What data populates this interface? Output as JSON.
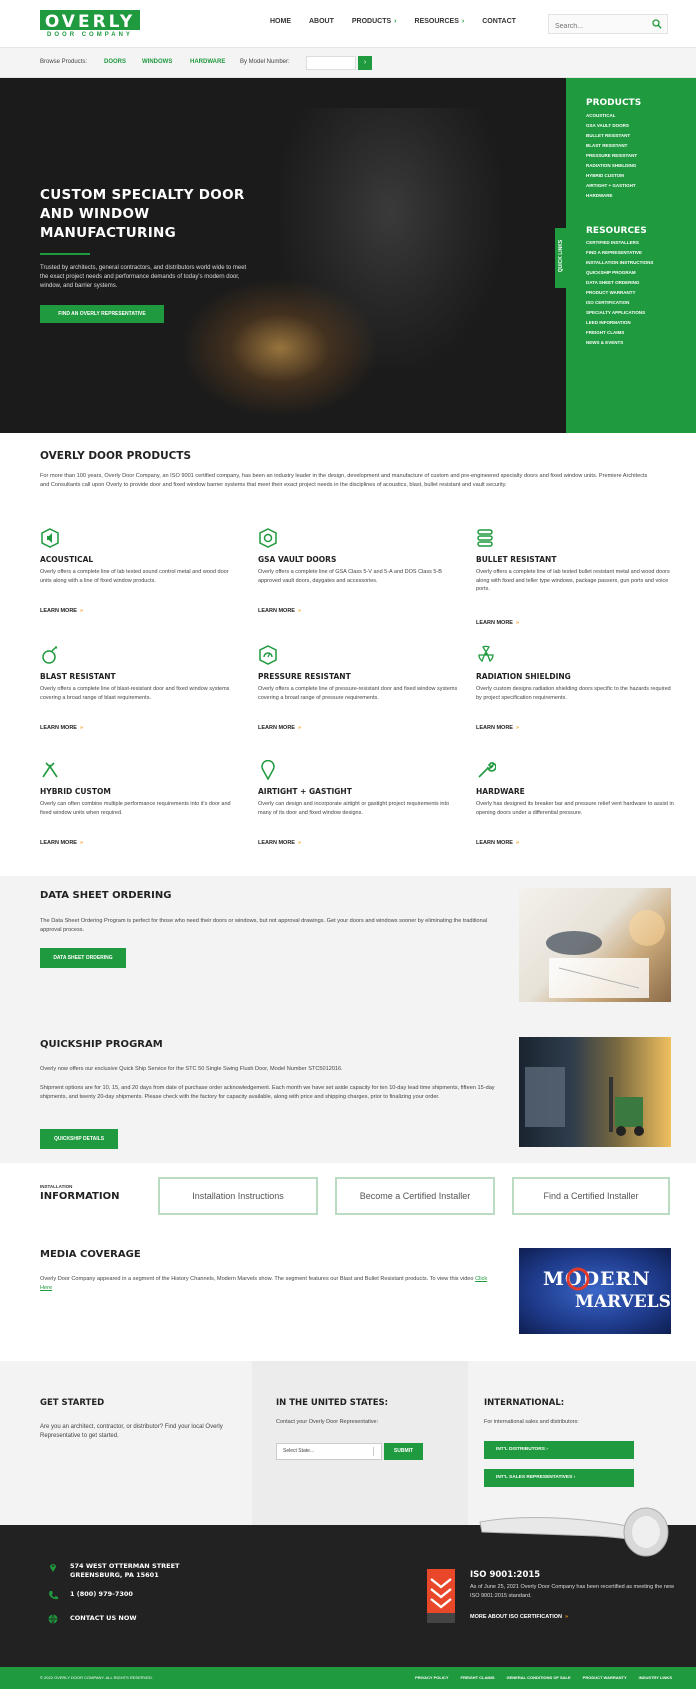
{
  "header": {
    "logo_main": "OVERLY",
    "logo_sub": "DOOR COMPANY",
    "nav": [
      {
        "label": "HOME",
        "chevron": ""
      },
      {
        "label": "ABOUT",
        "chevron": ""
      },
      {
        "label": "PRODUCTS",
        "chevron": "›"
      },
      {
        "label": "RESOURCES",
        "chevron": "›"
      },
      {
        "label": "CONTACT",
        "chevron": ""
      }
    ],
    "search_placeholder": "Search..."
  },
  "browse": {
    "label": "Browse Products:",
    "doors": "DOORS",
    "windows": "WINDOWS",
    "hardware": "HARDWARE",
    "model_label": "By Model Number:",
    "go": "›"
  },
  "hero": {
    "title": "CUSTOM SPECIALTY DOOR AND WINDOW MANUFACTURING",
    "text": "Trusted by architects, general contractors, and distributors world wide to meet the exact project needs and performance demands of today's modern door, window, and barrier systems.",
    "cta": "FIND AN OVERLY REPRESENTATIVE",
    "quick_links": "QUICK LINKS"
  },
  "side_menu": {
    "products_heading": "PRODUCTS",
    "products": [
      "ACOUSTICAL",
      "GSA VAULT DOORS",
      "BULLET RESISTANT",
      "BLAST RESISTANT",
      "PRESSURE RESISTANT",
      "RADIATION SHIELDING",
      "HYBRID CUSTOM",
      "AIRTIGHT + GASTIGHT",
      "HARDWARE"
    ],
    "resources_heading": "RESOURCES",
    "resources": [
      "CERTIFIED INSTALLERS",
      "FIND A REPRESENTATIVE",
      "INSTALLATION INSTRUCTIONS",
      "QUICKSHIP PROGRAM",
      "DATA SHEET ORDERING",
      "PRODUCT WARRANTY",
      "ISO CERTIFICATION",
      "SPECIALTY APPLICATIONS",
      "LEED INFORMATION",
      "FREIGHT CLAIMS",
      "NEWS & EVENTS"
    ]
  },
  "products": {
    "title": "OVERLY DOOR PRODUCTS",
    "intro": "For more than 100 years, Overly Door Company, an ISO 9001 certified company, has been an industry leader in the design, development and manufacture of custom and pre-engineered specialty doors and fixed window units. Premiere Architects and Consultants call upon Overly to provide door and fixed window barrier systems that meet their exact project needs in the disciplines of acoustics, blast, bullet resistant and vault security.",
    "learn_more": "LEARN MORE",
    "arrow": "»",
    "items": [
      {
        "title": "ACOUSTICAL",
        "text": "Overly offers a complete line of lab tested sound control metal and wood door units along with a line of fixed window products.",
        "icon": "acoustical-icon"
      },
      {
        "title": "GSA VAULT DOORS",
        "text": "Overly offers a complete line of GSA Class 5-V and 5-A and DOS Class 5-B approved vault doors, daygates and accessories.",
        "icon": "vault-icon"
      },
      {
        "title": "BULLET RESISTANT",
        "text": "Overly offers a complete line of lab tested bullet resistant metal and wood doors along with fixed and teller type windows, package passers, gun ports and voice ports.",
        "icon": "bullet-icon"
      },
      {
        "title": "BLAST RESISTANT",
        "text": "Overly offers a complete line of blast-resistant door and fixed window systems covering a broad range of blast requirements.",
        "icon": "bomb-icon"
      },
      {
        "title": "PRESSURE RESISTANT",
        "text": "Overly offers a complete line of pressure-resistant door and fixed window systems covering a broad range of pressure requirements.",
        "icon": "gauge-icon"
      },
      {
        "title": "RADIATION SHIELDING",
        "text": "Overly custom designs radiation shielding doors specific to the hazards required by project specification requirements.",
        "icon": "radiation-icon"
      },
      {
        "title": "HYBRID CUSTOM",
        "text": "Overly can often combine multiple performance requirements into it's door and fixed window units when required.",
        "icon": "tools-icon"
      },
      {
        "title": "AIRTIGHT + GASTIGHT",
        "text": "Overly can design and incorporate airtight or gastight project requirements into many of its door and fixed window designs.",
        "icon": "pin-icon"
      },
      {
        "title": "HARDWARE",
        "text": "Overly has designed its breaker bar and pressure relief vent hardware to assist in opening doors under a differential pressure.",
        "icon": "wrench-icon"
      }
    ]
  },
  "data_sheet": {
    "title": "DATA SHEET ORDERING",
    "text": "The Data Sheet Ordering Program is perfect for those who need their doors or windows, but not approval drawings. Get your doors and windows sooner by eliminating the traditional approval process.",
    "button": "DATA SHEET ORDERING"
  },
  "quickship": {
    "title": "QUICKSHIP PROGRAM",
    "text1": "Overly now offers our exclusive Quick Ship Service for the STC 50 Single Swing Flush Door, Model Number STC5012016.",
    "text2": "Shipment options are for 10, 15, and 20 days from date of purchase order acknowledgement. Each month we have set aside capacity for ten 10-day lead time shipments, fifteen 15-day shipments, and twenty 20-day shipments. Please check with the factory for capacity available, along with price and shipping charges, prior to finalizing your order.",
    "button": "QUICKSHIP DETAILS"
  },
  "installation": {
    "small": "INSTALLATION",
    "big": "INFORMATION",
    "buttons": [
      "Installation Instructions",
      "Become a Certified Installer",
      "Find a Certified Installer"
    ]
  },
  "media": {
    "title": "MEDIA COVERAGE",
    "text": "Overly Door Company appeared in a segment of the History Channels, Modern Marvels show. The segment features our Blast and Bullet Resistant products. To view this video",
    "link": "Click Here",
    "image_line1": "MODERN",
    "image_line2": "MARVELS"
  },
  "get_started": {
    "title": "GET STARTED",
    "text": "Are you an architect, contractor, or distributor? Find your local Overly Representative to get started.",
    "us_title": "IN THE UNITED STATES:",
    "us_text": "Contact your Overly Door Representative:",
    "select_placeholder": "Select State...",
    "submit": "SUBMIT",
    "intl_title": "INTERNATIONAL:",
    "intl_text": "For international sales and distributors:",
    "intl_dist": "INT'L DISTRIBUTORS",
    "intl_reps": "INT'L SALES REPRESENTATIVES",
    "arrow": "›"
  },
  "footer": {
    "address1": "574 WEST OTTERMAN STREET",
    "address2": "GREENSBURG, PA 15601",
    "phone": "1 (800) 979-7300",
    "contact": "CONTACT US NOW",
    "iso_title": "ISO 9001:2015",
    "iso_text": "As of June 25, 2021 Overly Door Company has been recertified as meeting the new ISO 9001:2015 standard.",
    "iso_link": "MORE ABOUT ISO CERTIFICATION",
    "arrow": "»"
  },
  "bottom_bar": {
    "copyright": "© 2022 OVERLY DOOR COMPANY. ALL RIGHTS RESERVED.",
    "links": [
      "PRIVACY POLICY",
      "FREIGHT CLAIMS",
      "GENERAL CONDITIONS OF SALE",
      "PRODUCT WARRANTY",
      "INDUSTRY LINKS"
    ]
  },
  "colors": {
    "brand_green": "#1f9a3e",
    "accent_orange": "#f39c12",
    "footer_dark": "#222222"
  }
}
